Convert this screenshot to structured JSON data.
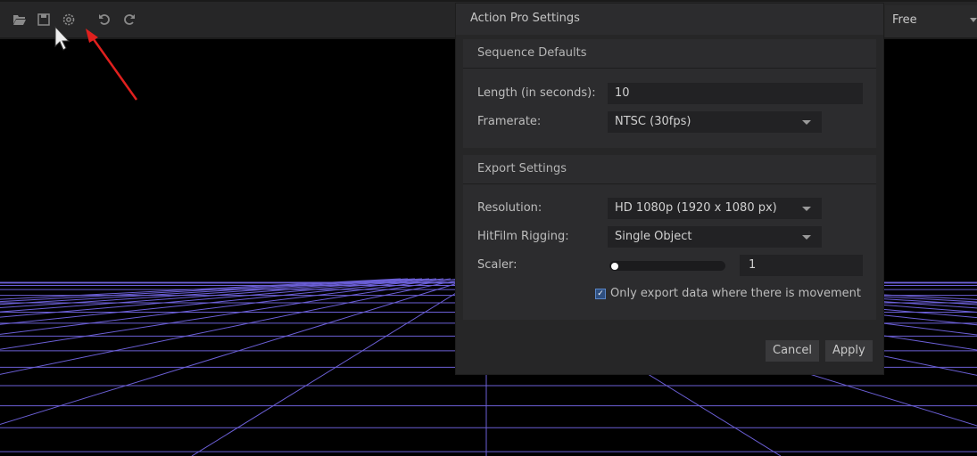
{
  "toolbar": {
    "icons": [
      "folder-open-icon",
      "save-icon",
      "gear-icon",
      "undo-icon",
      "redo-icon"
    ],
    "view_select": "Free"
  },
  "dialog": {
    "title": "Action Pro Settings",
    "sequence": {
      "header": "Sequence Defaults",
      "length_label": "Length (in seconds):",
      "length_value": "10",
      "framerate_label": "Framerate:",
      "framerate_value": "NTSC (30fps)"
    },
    "export": {
      "header": "Export Settings",
      "resolution_label": "Resolution:",
      "resolution_value": "HD 1080p (1920 x 1080 px)",
      "rigging_label": "HitFilm Rigging:",
      "rigging_value": "Single Object",
      "scaler_label": "Scaler:",
      "scaler_value": "1",
      "scaler_fraction": 0.0,
      "movement_checked": true,
      "movement_label": "Only export data where there is movement"
    },
    "cancel": "Cancel",
    "apply": "Apply"
  },
  "colors": {
    "grid": "#6b5fd6",
    "arrow": "#e0201e"
  }
}
